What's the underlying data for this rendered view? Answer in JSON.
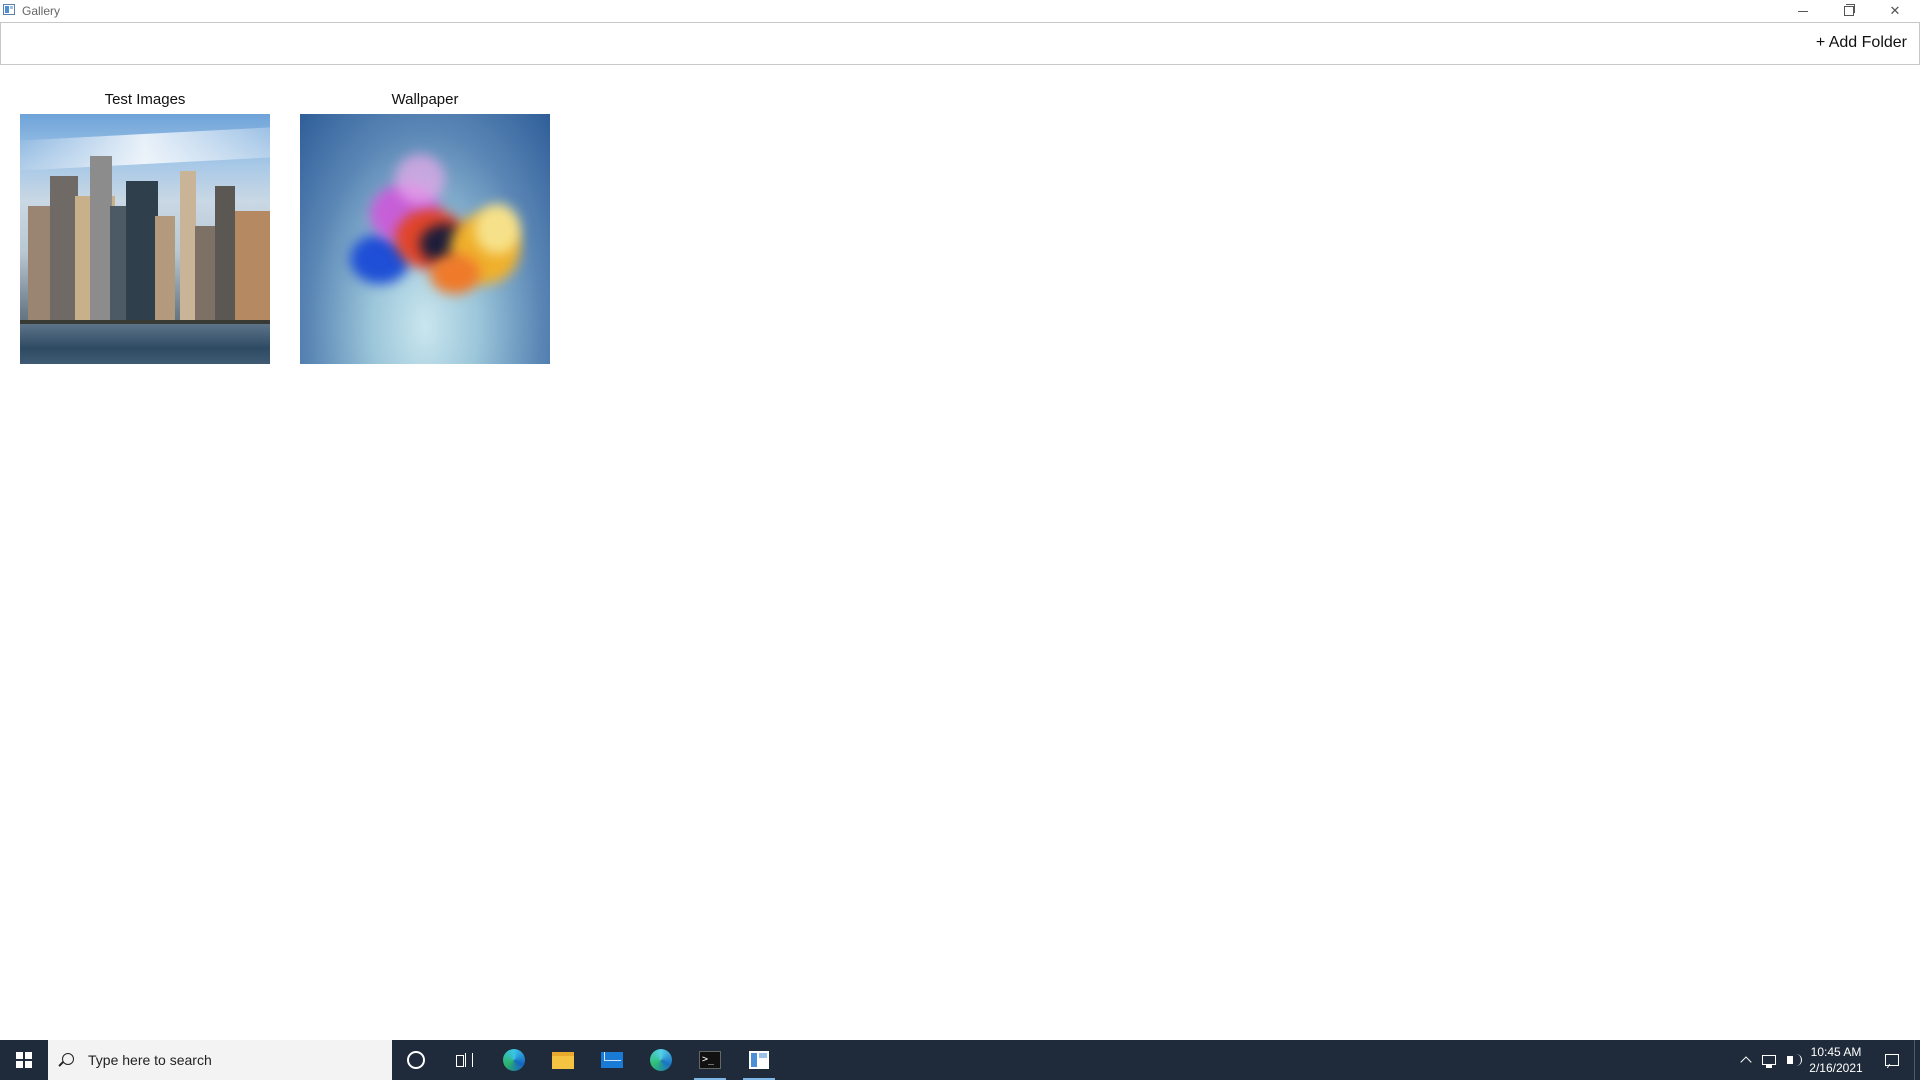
{
  "window": {
    "title": "Gallery"
  },
  "commandbar": {
    "add_folder_label": "+ Add Folder"
  },
  "folders": [
    {
      "title": "Test Images",
      "thumbnail": "city-skyline-photo"
    },
    {
      "title": "Wallpaper",
      "thumbnail": "color-powder-explosion-photo"
    }
  ],
  "taskbar": {
    "search_placeholder": "Type here to search",
    "pinned": [
      "cortana-icon",
      "task-view-icon",
      "edge-icon",
      "file-explorer-icon",
      "mail-icon",
      "edge-dev-icon",
      "terminal-icon",
      "gallery-app-icon"
    ],
    "active": [
      "terminal-icon",
      "gallery-app-icon"
    ],
    "clock_time": "10:45 AM",
    "clock_date": "2/16/2021"
  },
  "colors": {
    "taskbar_bg": "#1f2b3a",
    "search_bg": "#f3f3f3",
    "accent": "#7fb6e8"
  }
}
